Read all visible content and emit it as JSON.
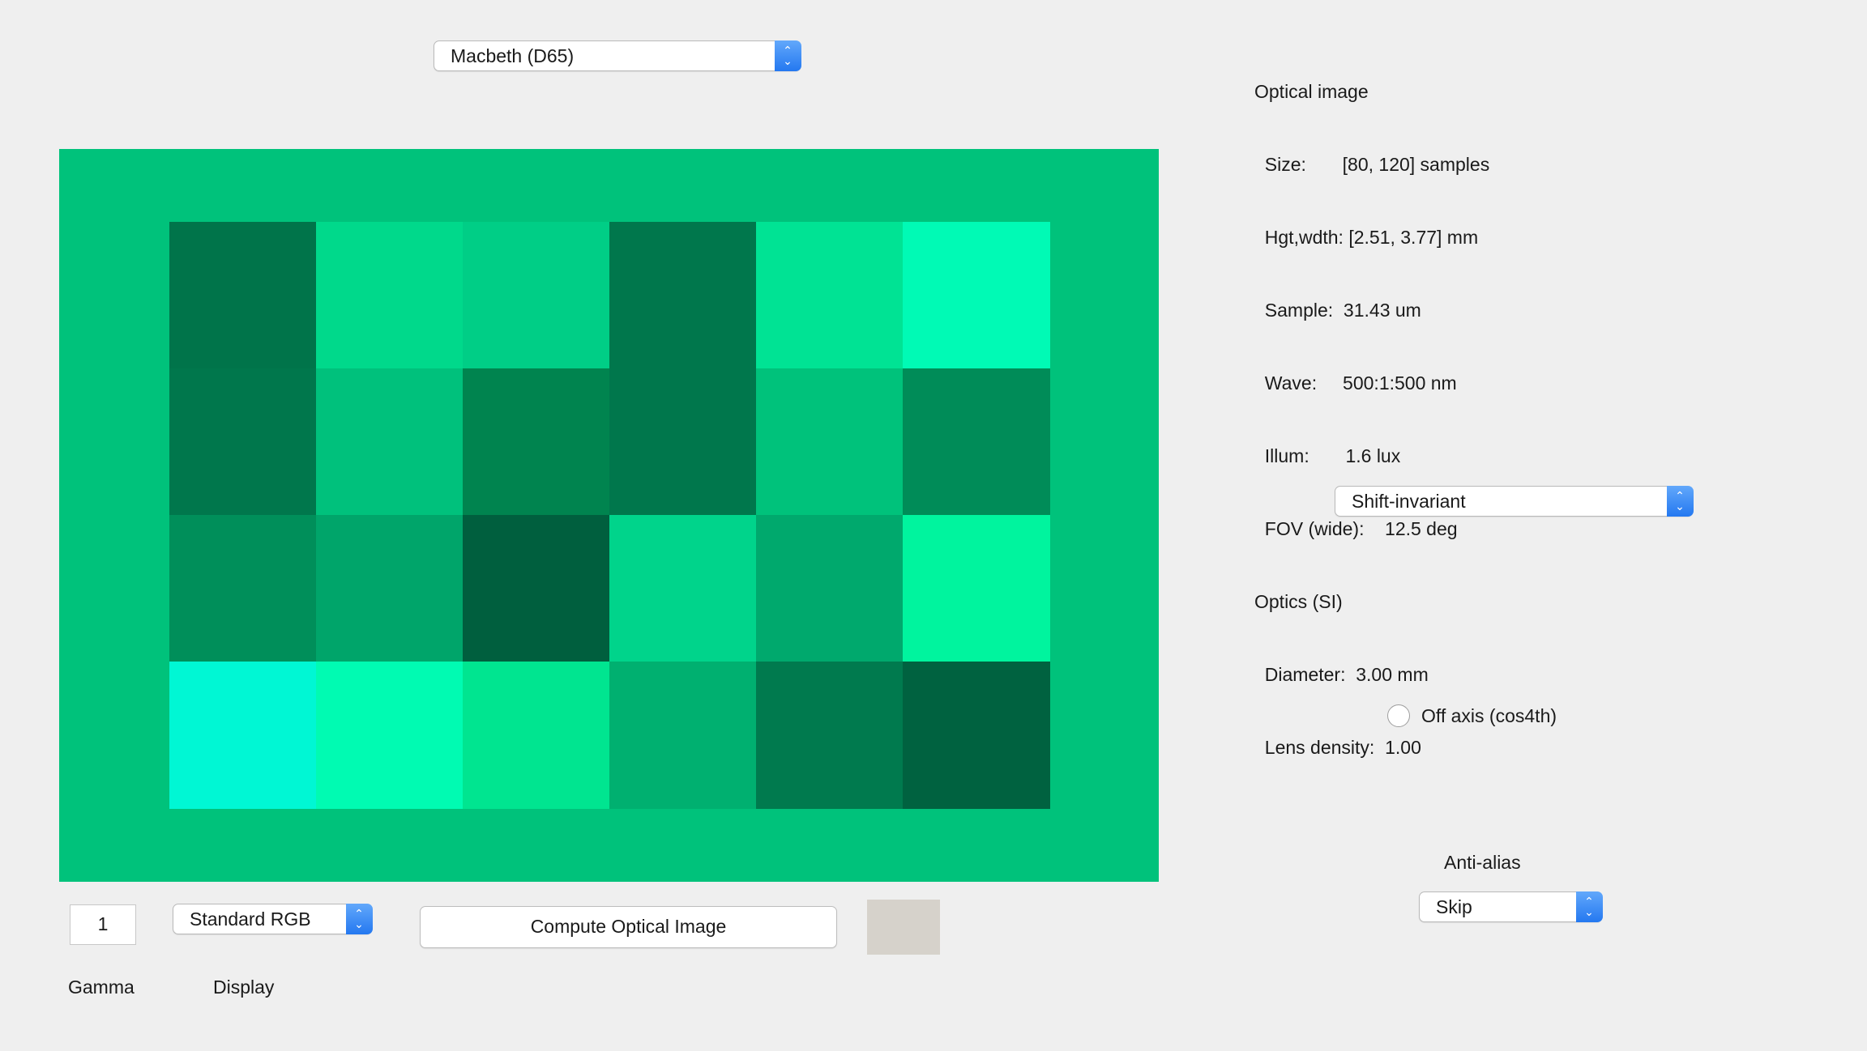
{
  "scene_popup": {
    "value": "Macbeth (D65)"
  },
  "optics_popup": {
    "value": "Shift-invariant"
  },
  "antialias": {
    "label": "Anti-alias",
    "value": "Skip"
  },
  "offaxis": {
    "label": "Off axis (cos4th)",
    "checked": false
  },
  "gamma": {
    "value": "1",
    "label": "Gamma"
  },
  "display": {
    "value": "Standard RGB",
    "label": "Display"
  },
  "compute_button": {
    "label": "Compute Optical Image"
  },
  "swatch": {
    "color": "#d6d2cb"
  },
  "info": {
    "optical_image_title": "Optical image",
    "lines": [
      "  Size:       [80, 120] samples",
      "  Hgt,wdth: [2.51, 3.77] mm",
      "  Sample:  31.43 um",
      "  Wave:     500:1:500 nm",
      "  Illum:       1.6 lux",
      "  FOV (wide):    12.5 deg"
    ],
    "optics_title": "Optics (SI)",
    "optics_lines": [
      "  Diameter:  3.00 mm",
      "  Lens density:  1.00"
    ]
  },
  "image": {
    "background_color": "#00c27b",
    "patches": [
      [
        "#00744a",
        "#00d98b",
        "#00ce86",
        "#00774c",
        "#00e394",
        "#00fab5"
      ],
      [
        "#00774c",
        "#00c17c",
        "#00844f",
        "#00774c",
        "#00c27b",
        "#008c58"
      ],
      [
        "#008f5a",
        "#00a56a",
        "#005f3e",
        "#00d48b",
        "#00a96d",
        "#00f49e"
      ],
      [
        "#00f7d4",
        "#00fbb2",
        "#00e590",
        "#00b070",
        "#007a4e",
        "#006240"
      ]
    ]
  }
}
